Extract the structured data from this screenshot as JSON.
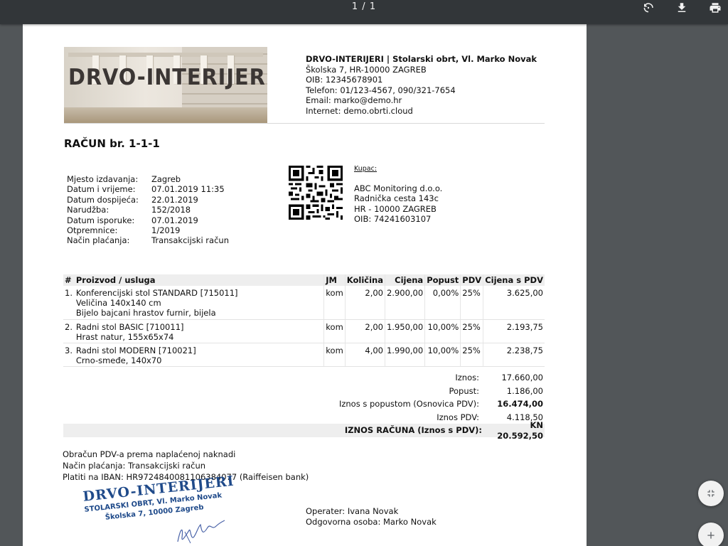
{
  "viewer": {
    "page_counter": "1 / 1",
    "icons": [
      "rotate-icon",
      "download-icon",
      "print-icon",
      "fit-to-page-icon",
      "zoom-in-icon"
    ]
  },
  "logo": {
    "wordmark": "DRVO-INTERIJERI"
  },
  "company": {
    "name": "DRVO-INTERIJERI | Stolarski obrt, Vl. Marko Novak",
    "address": "Školska 7, HR-10000 ZAGREB",
    "oib": "OIB: 12345678901",
    "phone": "Telefon: 01/123-4567, 090/321-7654",
    "email": "Email: marko@demo.hr",
    "web": "Internet: demo.obrti.cloud"
  },
  "invoice": {
    "title": "RAČUN br. 1-1-1",
    "meta": [
      {
        "label": "Mjesto izdavanja:",
        "value": "Zagreb"
      },
      {
        "label": "Datum i vrijeme:",
        "value": "07.01.2019 11:35"
      },
      {
        "label": "Datum dospijeća:",
        "value": "22.01.2019"
      },
      {
        "label": "Narudžba:",
        "value": "152/2018"
      },
      {
        "label": "Datum isporuke:",
        "value": "07.01.2019"
      },
      {
        "label": "Otpremnice:",
        "value": "1/2019"
      },
      {
        "label": "Način plaćanja:",
        "value": "Transakcijski račun"
      }
    ]
  },
  "buyer": {
    "caption": "Kupac:",
    "name": "ABC Monitoring d.o.o.",
    "street": "Radnička cesta 143c",
    "city": "HR - 10000 ZAGREB",
    "oib": "OIB: 74241603107"
  },
  "items": {
    "headers": [
      "#",
      "Proizvod / usluga",
      "JM",
      "Količina",
      "Cijena",
      "Popust",
      "PDV",
      "Cijena s PDV"
    ],
    "rows": [
      {
        "no": "1.",
        "lines": [
          "Konferencijski stol STANDARD [715011]",
          "Veličina 140x140 cm",
          "Bijelo bajcani hrastov furnir, bijela"
        ],
        "unit": "kom",
        "qty": "2,00",
        "price": "2.900,00",
        "discount": "0,00%",
        "vat": "25%",
        "total": "3.625,00"
      },
      {
        "no": "2.",
        "lines": [
          "Radni stol BASIC [710011]",
          "Hrast natur, 155x65x74"
        ],
        "unit": "kom",
        "qty": "2,00",
        "price": "1.950,00",
        "discount": "10,00%",
        "vat": "25%",
        "total": "2.193,75"
      },
      {
        "no": "3.",
        "lines": [
          "Radni stol MODERN [710021]",
          "Crno-smeđe, 140x70"
        ],
        "unit": "kom",
        "qty": "4,00",
        "price": "1.990,00",
        "discount": "10,00%",
        "vat": "25%",
        "total": "2.238,75"
      }
    ]
  },
  "totals": {
    "amount_label": "Iznos:",
    "amount": "17.660,00",
    "discount_label": "Popust:",
    "discount": "1.186,00",
    "base_label": "Iznos s popustom (Osnovica PDV):",
    "base": "16.474,00",
    "vat_label": "Iznos PDV:",
    "vat": "4.118,50",
    "grand_label": "IZNOS RAČUNA (Iznos s PDV):",
    "grand": "KN 20.592,50"
  },
  "notes": {
    "line1": "Obračun PDV-a prema naplaćenoj naknadi",
    "line2": "Način plaćanja: Transakcijski račun",
    "line3": "Platiti na IBAN: HR9724840081106384077 (Raiffeisen bank)"
  },
  "stamp": {
    "line1": "DRVO-INTERIJERI",
    "line2": "STOLARSKI OBRT, Vl. Marko Novak",
    "line3": "Školska 7, 10000 Zagreb",
    "color": "#1f4a8a"
  },
  "operator": {
    "operator": "Operater: Ivana Novak",
    "responsible": "Odgovorna osoba: Marko Novak"
  }
}
